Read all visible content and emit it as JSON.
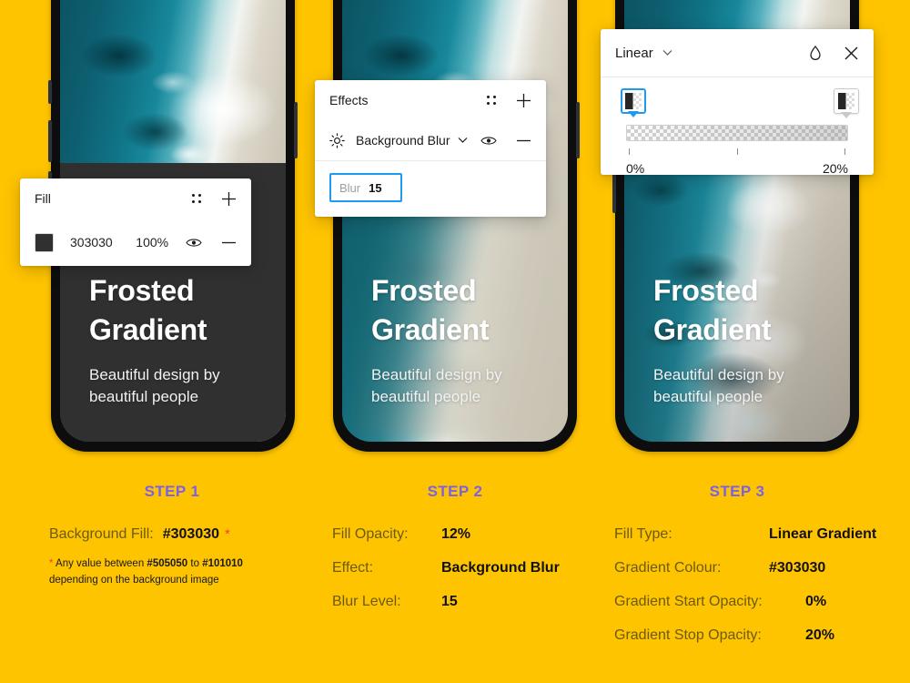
{
  "theme": {
    "background": "#FFC400",
    "accent_purple": "#7B61E8",
    "accent_blue": "#1E9BF0",
    "accent_red": "#F2442E",
    "fill_color": "#303030"
  },
  "phones": [
    {
      "title_line1": "Frosted",
      "title_line2": "Gradient",
      "subtitle_line1": "Beautiful design by",
      "subtitle_line2": "beautiful people"
    },
    {
      "title_line1": "Frosted",
      "title_line2": "Gradient",
      "subtitle_line1": "Beautiful design by",
      "subtitle_line2": "beautiful people"
    },
    {
      "title_line1": "Frosted",
      "title_line2": "Gradient",
      "subtitle_line1": "Beautiful design by",
      "subtitle_line2": "beautiful people"
    }
  ],
  "fill_panel": {
    "title": "Fill",
    "swatch_color": "#303030",
    "hex": "303030",
    "opacity": "100%",
    "icons": [
      "grid-dots-icon",
      "plus-icon",
      "eye-icon",
      "minus-icon"
    ]
  },
  "effects_panel": {
    "title": "Effects",
    "effect_name": "Background Blur",
    "blur_placeholder": "Blur",
    "blur_value": "15",
    "icons": [
      "grid-dots-icon",
      "plus-icon",
      "sun-icon",
      "chevron-down-icon",
      "eye-icon",
      "minus-icon"
    ]
  },
  "gradient_panel": {
    "type": "Linear",
    "start_label": "0%",
    "stop_label": "20%",
    "icons": [
      "chevron-down-icon",
      "droplet-icon",
      "close-icon"
    ]
  },
  "steps": [
    {
      "heading": "STEP 1",
      "rows": [
        {
          "label": "Background Fill:",
          "value": "#303030",
          "has_asterisk": true
        }
      ],
      "footnote_prefix": "*",
      "footnote_line1_a": " Any value between ",
      "footnote_hex_from": "#505050",
      "footnote_line1_b": " to ",
      "footnote_hex_to": "#101010",
      "footnote_line2": "depending on the background image"
    },
    {
      "heading": "STEP 2",
      "rows": [
        {
          "label": "Fill Opacity:",
          "value": "12%"
        },
        {
          "label": "Effect:",
          "value": "Background Blur"
        },
        {
          "label": "Blur Level:",
          "value": "15"
        }
      ]
    },
    {
      "heading": "STEP 3",
      "rows": [
        {
          "label": "Fill Type:",
          "value": "Linear Gradient"
        },
        {
          "label": "Gradient Colour:",
          "value": "#303030"
        },
        {
          "label": "Gradient Start Opacity:",
          "value": "0%"
        },
        {
          "label": "Gradient Stop Opacity:",
          "value": "20%"
        }
      ]
    }
  ]
}
